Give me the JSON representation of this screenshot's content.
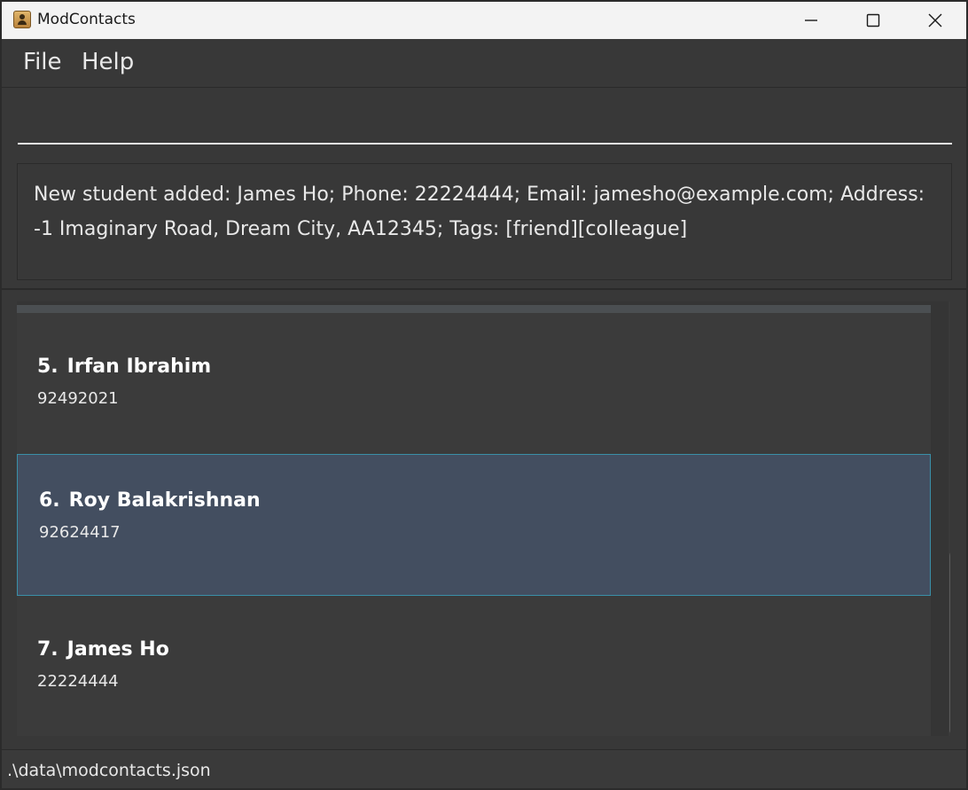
{
  "window": {
    "title": "ModContacts"
  },
  "menu": {
    "file": "File",
    "help": "Help"
  },
  "command": {
    "value": ""
  },
  "result": {
    "text": "New student added: James Ho; Phone: 22224444; Email: jamesho@example.com; Address: -1 Imaginary Road, Dream City, AA12345; Tags: [friend][colleague]"
  },
  "persons": [
    {
      "index": "5.",
      "name": "Irfan Ibrahim",
      "phone": "92492021"
    },
    {
      "index": "6.",
      "name": "Roy Balakrishnan",
      "phone": "92624417"
    },
    {
      "index": "7.",
      "name": "James Ho",
      "phone": "22224444"
    }
  ],
  "selected_person": "6.",
  "status": {
    "file_path": ".\\data\\modcontacts.json"
  },
  "colors": {
    "background": "#383838",
    "selected_card": "#434e60",
    "selected_border": "#3a8fa8",
    "titlebar": "#f3f3f3"
  },
  "icons": {
    "app": "contacts-book-icon",
    "minimize": "minimize-icon",
    "maximize": "maximize-icon",
    "close": "close-icon"
  }
}
